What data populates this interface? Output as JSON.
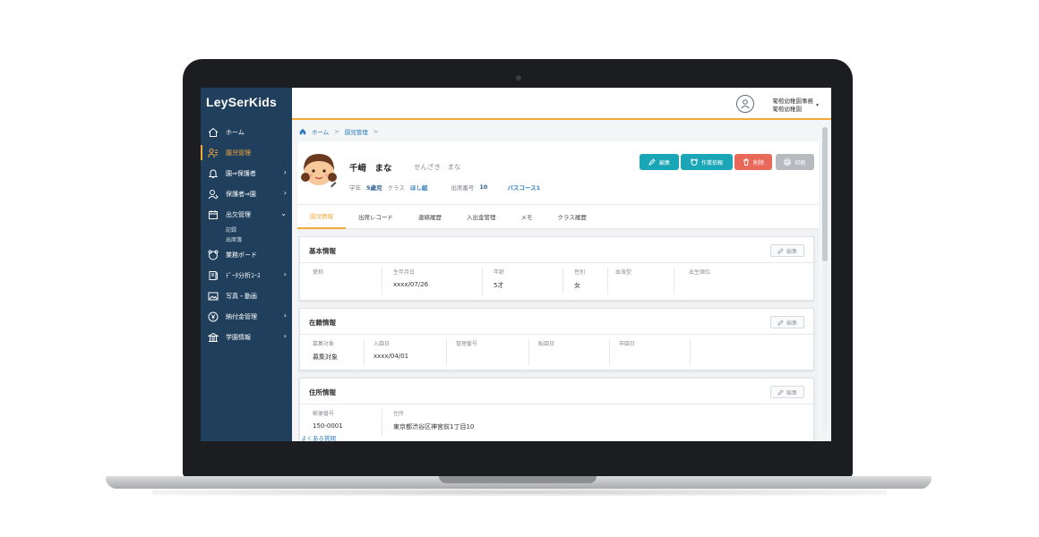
{
  "app": {
    "logo": "LeySerKids"
  },
  "sidebar": {
    "items": [
      {
        "label": "ホーム",
        "icon": "home-icon",
        "chevron": ""
      },
      {
        "label": "園児管理",
        "icon": "children-icon",
        "chevron": ""
      },
      {
        "label": "園⇒保護者",
        "icon": "bell-icon",
        "chevron": "›"
      },
      {
        "label": "保護者⇒園",
        "icon": "parent-icon",
        "chevron": "›"
      },
      {
        "label": "出欠管理",
        "icon": "calendar-icon",
        "chevron": "⌄"
      },
      {
        "label": "業務ボード",
        "icon": "board-icon",
        "chevron": ""
      },
      {
        "label": "ﾃﾞｰﾀ分析ｺｰｽ",
        "icon": "book-icon",
        "chevron": "›"
      },
      {
        "label": "写真・動画",
        "icon": "photo-icon",
        "chevron": ""
      },
      {
        "label": "納付金管理",
        "icon": "yen-icon",
        "chevron": "›"
      },
      {
        "label": "学園情報",
        "icon": "school-icon",
        "chevron": "›"
      }
    ],
    "sub_items": [
      "記録",
      "出席簿"
    ]
  },
  "header": {
    "user_line1": "葡萄幼稚園事務",
    "user_line2": "葡萄幼稚園",
    "caret": "▾"
  },
  "breadcrumb": {
    "home": "ホーム",
    "current": "園児管理",
    "sep": ">"
  },
  "student": {
    "name": "千﨑　まな",
    "kana": "せんざき　まな",
    "grade_label": "学年",
    "grade_value": "5歳児",
    "class_label": "クラス",
    "class_value": "ほし組",
    "number_label": "出席番号",
    "number_value": "10",
    "bus_value": "バスコース1"
  },
  "actions": {
    "edit": "編集",
    "work_request": "作業依頼",
    "delete": "削除",
    "print": "印刷"
  },
  "tabs": [
    "園児情報",
    "出席レコード",
    "連絡履歴",
    "入出金管理",
    "メモ",
    "クラス履歴"
  ],
  "sections": {
    "basic": {
      "title": "基本情報",
      "edit": "編集",
      "fields": [
        {
          "label": "愛称",
          "value": ""
        },
        {
          "label": "生年月日",
          "value": "xxxx/07/26"
        },
        {
          "label": "年齢",
          "value": "5才"
        },
        {
          "label": "性別",
          "value": "女"
        },
        {
          "label": "血液型",
          "value": ""
        },
        {
          "label": "出生順位",
          "value": ""
        }
      ]
    },
    "enrollment": {
      "title": "在籍情報",
      "edit": "編集",
      "fields": [
        {
          "label": "募集対象",
          "value": "募集対象"
        },
        {
          "label": "入園日",
          "value": "xxxx/04/01"
        },
        {
          "label": "管理番号",
          "value": ""
        },
        {
          "label": "転園日",
          "value": ""
        },
        {
          "label": "卒園日",
          "value": ""
        }
      ]
    },
    "address": {
      "title": "住所情報",
      "edit": "編集",
      "fields": [
        {
          "label": "郵便番号",
          "value": "150-0001"
        },
        {
          "label": "住所",
          "value": "東京都渋谷区神宮前1丁目10"
        }
      ]
    }
  },
  "footer": {
    "faq": "よくある質問"
  },
  "colors": {
    "sidebar": "#1f3f5c",
    "accent": "#f2a93b",
    "teal": "#1aa6b7",
    "danger": "#e8685a"
  }
}
